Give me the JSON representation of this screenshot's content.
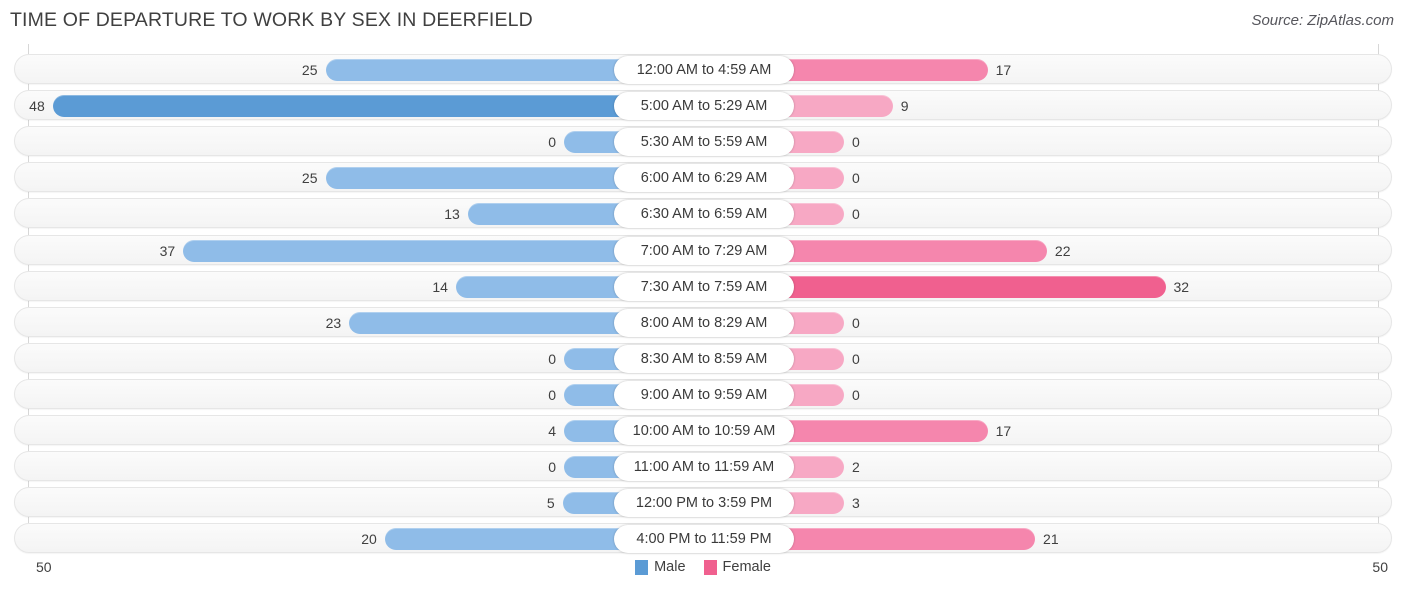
{
  "header": {
    "title": "TIME OF DEPARTURE TO WORK BY SEX IN DEERFIELD",
    "source": "Source: ZipAtlas.com"
  },
  "legend": {
    "items": [
      {
        "label": "Male",
        "color": "#5b9bd5"
      },
      {
        "label": "Female",
        "color": "#f0608f"
      }
    ]
  },
  "axis": {
    "left_tick": "50",
    "right_tick": "50",
    "max": 50
  },
  "colors": {
    "male_light": "#8fbce8",
    "male_dark": "#5b9bd5",
    "female_light": "#f7a8c4",
    "female_mid": "#f586ad",
    "female_dark": "#f0608f",
    "track_border": "#e6e6e6",
    "axis_line": "#d7d7d7",
    "text": "#404040"
  },
  "chart_data": {
    "type": "bar",
    "title": "TIME OF DEPARTURE TO WORK BY SEX IN DEERFIELD",
    "subtitle": "",
    "xlabel": "",
    "ylabel": "",
    "orientation": "horizontal-diverging",
    "xlim": [
      50,
      50
    ],
    "grid": false,
    "legend_position": "bottom-center",
    "categories": [
      "12:00 AM to 4:59 AM",
      "5:00 AM to 5:29 AM",
      "5:30 AM to 5:59 AM",
      "6:00 AM to 6:29 AM",
      "6:30 AM to 6:59 AM",
      "7:00 AM to 7:29 AM",
      "7:30 AM to 7:59 AM",
      "8:00 AM to 8:29 AM",
      "8:30 AM to 8:59 AM",
      "9:00 AM to 9:59 AM",
      "10:00 AM to 10:59 AM",
      "11:00 AM to 11:59 AM",
      "12:00 PM to 3:59 PM",
      "4:00 PM to 11:59 PM"
    ],
    "series": [
      {
        "name": "Male",
        "color": "#5b9bd5",
        "values": [
          25,
          48,
          0,
          25,
          13,
          37,
          14,
          23,
          0,
          0,
          4,
          0,
          5,
          20
        ]
      },
      {
        "name": "Female",
        "color": "#f0608f",
        "values": [
          17,
          9,
          0,
          0,
          0,
          22,
          32,
          0,
          0,
          0,
          17,
          2,
          3,
          21
        ]
      }
    ]
  },
  "rows": [
    {
      "label": "12:00 AM to 4:59 AM",
      "male": "25",
      "female": "17"
    },
    {
      "label": "5:00 AM to 5:29 AM",
      "male": "48",
      "female": "9"
    },
    {
      "label": "5:30 AM to 5:59 AM",
      "male": "0",
      "female": "0"
    },
    {
      "label": "6:00 AM to 6:29 AM",
      "male": "25",
      "female": "0"
    },
    {
      "label": "6:30 AM to 6:59 AM",
      "male": "13",
      "female": "0"
    },
    {
      "label": "7:00 AM to 7:29 AM",
      "male": "37",
      "female": "22"
    },
    {
      "label": "7:30 AM to 7:59 AM",
      "male": "14",
      "female": "32"
    },
    {
      "label": "8:00 AM to 8:29 AM",
      "male": "23",
      "female": "0"
    },
    {
      "label": "8:30 AM to 8:59 AM",
      "male": "0",
      "female": "0"
    },
    {
      "label": "9:00 AM to 9:59 AM",
      "male": "0",
      "female": "0"
    },
    {
      "label": "10:00 AM to 10:59 AM",
      "male": "4",
      "female": "17"
    },
    {
      "label": "11:00 AM to 11:59 AM",
      "male": "0",
      "female": "2"
    },
    {
      "label": "12:00 PM to 3:59 PM",
      "male": "5",
      "female": "3"
    },
    {
      "label": "4:00 PM to 11:59 PM",
      "male": "20",
      "female": "21"
    }
  ]
}
